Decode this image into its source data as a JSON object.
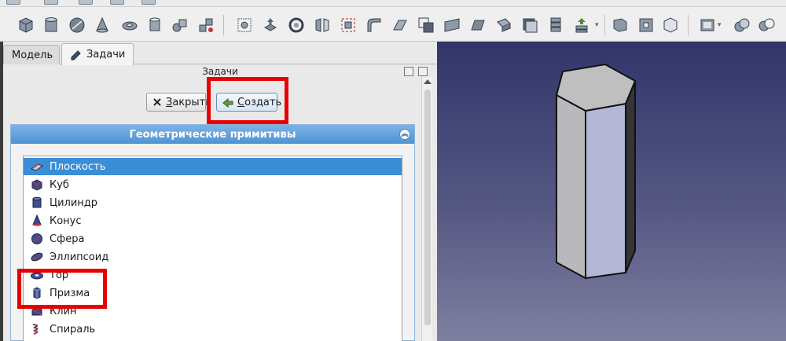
{
  "tabs": [
    {
      "label": "Модель"
    },
    {
      "label": "Задачи"
    }
  ],
  "pane": {
    "title": "Задачи"
  },
  "buttons": {
    "close_label": "Закрыть",
    "close_mnemonic": "З",
    "close_rest": "акрыть",
    "create_label": "Создать",
    "create_mnemonic": "С",
    "create_rest": "оздать"
  },
  "group": {
    "title": "Геометрические примитивы"
  },
  "primitives": [
    {
      "label": "Плоскость",
      "icon": "plane-icon",
      "selected": true
    },
    {
      "label": "Куб",
      "icon": "box-icon"
    },
    {
      "label": "Цилиндр",
      "icon": "cylinder-icon"
    },
    {
      "label": "Конус",
      "icon": "cone-icon"
    },
    {
      "label": "Сфера",
      "icon": "sphere-icon"
    },
    {
      "label": "Эллипсоид",
      "icon": "ellipsoid-icon"
    },
    {
      "label": "Тор",
      "icon": "torus-icon"
    },
    {
      "label": "Призма",
      "icon": "prism-icon"
    },
    {
      "label": "Клин",
      "icon": "wedge-icon"
    },
    {
      "label": "Спираль",
      "icon": "helix-icon"
    }
  ],
  "colors": {
    "highlight_frame": "#e60000",
    "selection": "#3a8ed6",
    "group_header": "#4f93d3",
    "viewport_top": "#32356a",
    "viewport_bottom": "#7f7fa0"
  }
}
